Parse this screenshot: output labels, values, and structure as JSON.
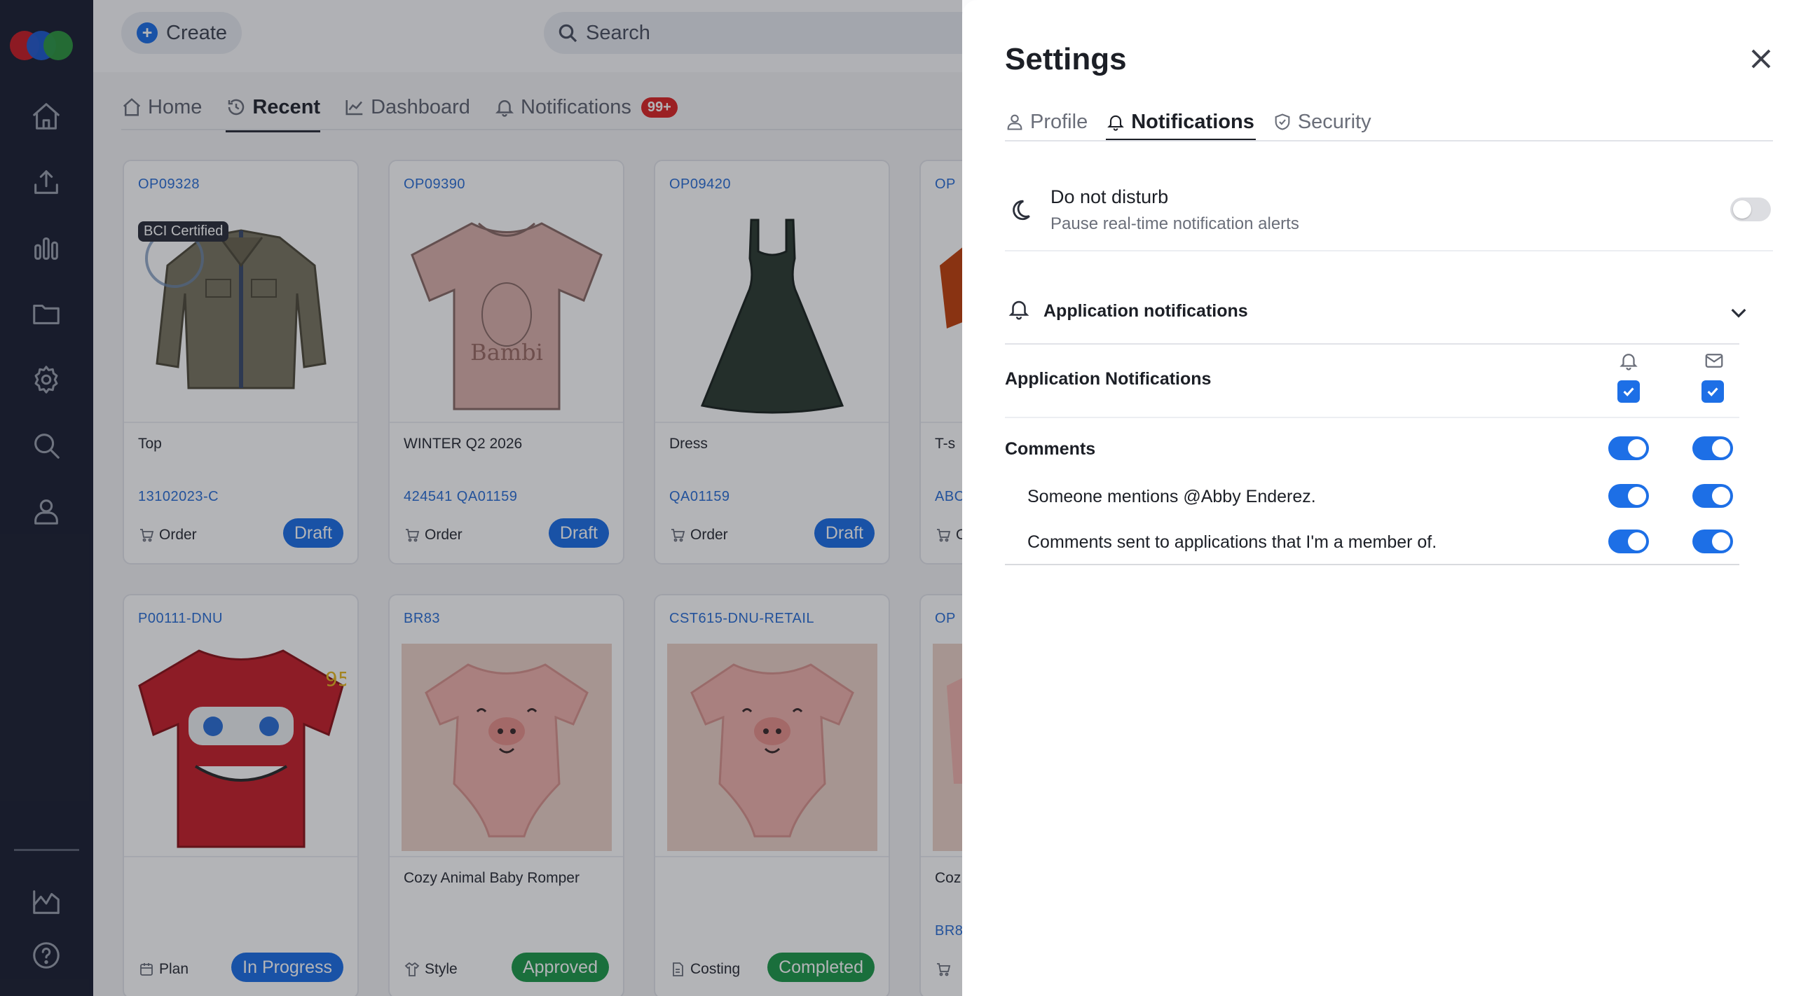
{
  "topbar": {
    "create_label": "Create",
    "search_placeholder": "Search"
  },
  "nav_tabs": [
    {
      "label": "Home",
      "icon": "home-icon"
    },
    {
      "label": "Recent",
      "icon": "history-icon",
      "active": true
    },
    {
      "label": "Dashboard",
      "icon": "chart-icon"
    },
    {
      "label": "Notifications",
      "icon": "bell-icon",
      "badge": "99+"
    }
  ],
  "sidebar": {
    "icons": [
      "home-icon",
      "upload-icon",
      "bar-chart-icon",
      "folder-icon",
      "gear-icon",
      "search-icon",
      "user-icon",
      "analytics-icon",
      "help-icon"
    ]
  },
  "cards": [
    {
      "code": "OP09328",
      "badge": "BCI Certified",
      "title": "Top",
      "ref": "13102023-C",
      "type": "Order",
      "status": "Draft",
      "status_color": "#1d6fe6",
      "image": "jacket"
    },
    {
      "code": "OP09390",
      "title": "WINTER Q2 2026",
      "ref": "424541 QA01159",
      "type": "Order",
      "status": "Draft",
      "status_color": "#1d6fe6",
      "image": "tshirt"
    },
    {
      "code": "OP09420",
      "title": "Dress",
      "ref": "QA01159",
      "type": "Order",
      "status": "Draft",
      "status_color": "#1d6fe6",
      "image": "dress"
    },
    {
      "code": "OP",
      "title": "T-s",
      "ref": "ABC",
      "type": "O",
      "image": "partial"
    },
    {
      "code": "P00111-DNU",
      "title": "",
      "ref": "",
      "type": "Plan",
      "status": "In Progress",
      "status_color": "#1d6fe6",
      "image": "red-tshirt"
    },
    {
      "code": "BR83",
      "title": "Cozy Animal Baby Romper",
      "ref": "",
      "type": "Style",
      "status": "Approved",
      "status_color": "#1e9a4b",
      "image": "romper"
    },
    {
      "code": "CST615-DNU-RETAIL",
      "title": "",
      "ref": "",
      "type": "Costing",
      "status": "Completed",
      "status_color": "#1e9a4b",
      "image": "romper"
    },
    {
      "code": "OP",
      "title": "Coz",
      "ref": "BR8",
      "type": "",
      "image": "partial"
    }
  ],
  "settings": {
    "title": "Settings",
    "tabs": [
      {
        "label": "Profile",
        "icon": "user-icon"
      },
      {
        "label": "Notifications",
        "icon": "bell-icon",
        "active": true
      },
      {
        "label": "Security",
        "icon": "shield-icon"
      }
    ],
    "do_not_disturb": {
      "title": "Do not disturb",
      "subtitle": "Pause real-time notification alerts",
      "enabled": false
    },
    "app_notifications": {
      "section_title": "Application notifications",
      "header_label": "Application Notifications",
      "header_bell_checked": true,
      "header_email_checked": true,
      "rows": [
        {
          "label": "Comments",
          "bell": true,
          "email": true
        },
        {
          "label": "Someone mentions @Abby Enderez.",
          "bell": true,
          "email": true
        },
        {
          "label": "Comments sent to applications that I'm a member of.",
          "bell": true,
          "email": true
        }
      ]
    }
  }
}
